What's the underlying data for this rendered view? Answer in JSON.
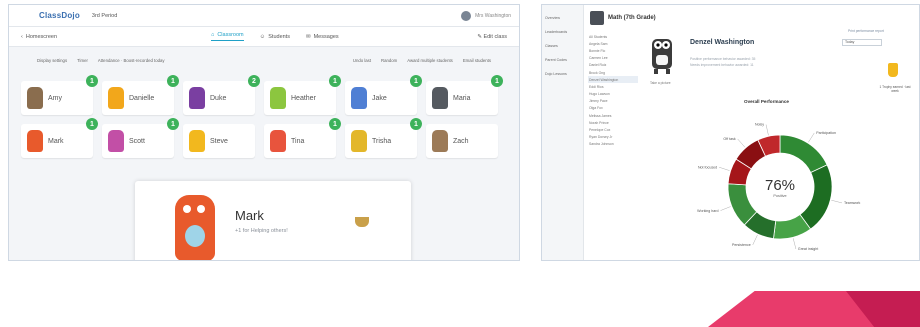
{
  "left": {
    "logo": "ClassDojo",
    "class_name": "3rd Period",
    "user": "Mrs Washington",
    "nav": {
      "back": "Homescreen",
      "tabs": [
        {
          "label": "Classroom",
          "icon": "home-icon",
          "active": true
        },
        {
          "label": "Students",
          "icon": "users-icon",
          "active": false
        },
        {
          "label": "Messages",
          "icon": "message-icon",
          "active": false
        }
      ],
      "edit": "Edit class"
    },
    "tools": [
      "Display settings",
      "Timer",
      "Attendance · Boost-recorded today",
      "Undo last",
      "Random",
      "Award multiple students",
      "Email students"
    ],
    "students_row1": [
      {
        "name": "Amy",
        "badge": "1",
        "color": "#8a6d4e"
      },
      {
        "name": "Danielle",
        "badge": "1",
        "color": "#f2a71b"
      },
      {
        "name": "Duke",
        "badge": "2",
        "color": "#7a3fa1"
      },
      {
        "name": "Heather",
        "badge": "1",
        "color": "#8cc63f"
      },
      {
        "name": "Jake",
        "badge": "1",
        "color": "#4f7fd4"
      },
      {
        "name": "Maria",
        "badge": "1",
        "color": "#555a60"
      }
    ],
    "students_row2": [
      {
        "name": "Mark",
        "badge": "1",
        "color": "#e85a2c"
      },
      {
        "name": "Scott",
        "badge": "1",
        "color": "#c24fa6"
      },
      {
        "name": "Steve",
        "badge": "",
        "color": "#f2b81e"
      },
      {
        "name": "Tina",
        "badge": "1",
        "color": "#e8543d"
      },
      {
        "name": "Trisha",
        "badge": "1",
        "color": "#e3b72a"
      },
      {
        "name": "Zach",
        "badge": "",
        "color": "#9c7a57"
      }
    ],
    "modal": {
      "name": "Mark",
      "subtitle": "+1 for Helping others!"
    }
  },
  "right": {
    "class_title": "Math (7th Grade)",
    "sidebar": [
      "Overview",
      "Leaderboards",
      "Classes",
      "Parent Codes",
      "Dojo Lessons"
    ],
    "student_list": [
      "All Students",
      "Angela Sam",
      "Bonnie Flo",
      "Carmen Lee",
      "Daniel Ruiz",
      "Brock Ong",
      "Denzel Washington",
      "Eddi Rios",
      "Hugo Lawson",
      "Jimmy Pace",
      "Olga Fox",
      "Melissa James",
      "Norah Prince",
      "Penelope Cox",
      "Ryan Dorsey Jr",
      "Sandra Johnson"
    ],
    "avatar_caption": "Take a picture",
    "student_name": "Denzel Washington",
    "faint_lines": [
      "Positive performance behavior awarded: 35",
      "Needs improvement behavior awarded: 11"
    ],
    "print_link": "Print performance report",
    "select_value": "Today",
    "trophy_text": "1 Trophy earned · last week",
    "chart_title": "Overall Performance",
    "percent": "76%",
    "percent_label": "Positive"
  },
  "chart_data": {
    "type": "pie",
    "title": "Overall Performance",
    "center_label": "76% Positive",
    "categories": [
      "Participation",
      "Teamwork",
      "Great insight",
      "Persistence",
      "Working hard",
      "Not focused",
      "Off task",
      "Noisy"
    ],
    "values": [
      18,
      22,
      12,
      10,
      14,
      8,
      9,
      7
    ],
    "colors": [
      "#2f8a34",
      "#1d6d22",
      "#47a347",
      "#256f2b",
      "#3a8f3d",
      "#a5161a",
      "#8a0f12",
      "#c0282b"
    ]
  }
}
